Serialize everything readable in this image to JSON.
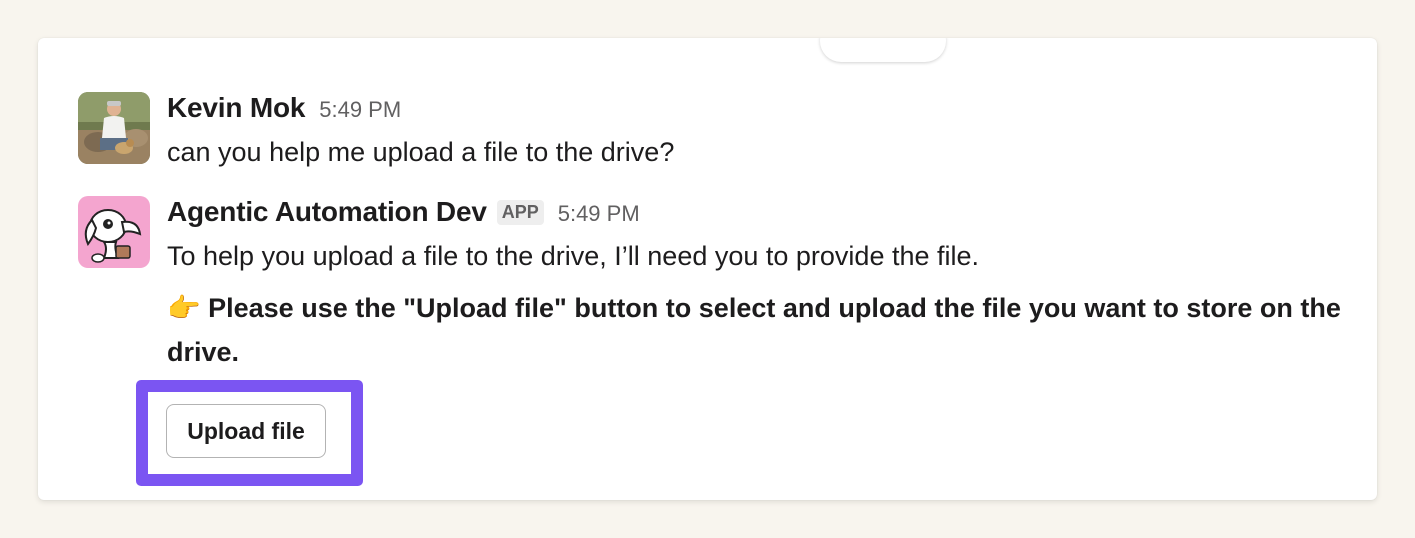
{
  "messages": [
    {
      "author": "Kevin Mok",
      "time": "5:49 PM",
      "text": "can you help me upload a file to the drive?",
      "avatar": "user-photo-avatar"
    },
    {
      "author": "Agentic Automation Dev",
      "badge": "APP",
      "time": "5:49 PM",
      "text": "To help you upload a file to the drive, I’ll need you to provide the file.",
      "emoji": "👉",
      "bold_text": " Please use the \"Upload file\" button to select and upload the file you want to store on the drive.",
      "button_label": "Upload file",
      "avatar": "bot-dog-avatar"
    }
  ],
  "colors": {
    "background": "#f8f5ee",
    "highlight": "#7b55f2",
    "bot_avatar_bg": "#f4a5cf",
    "timestamp": "#616061"
  }
}
